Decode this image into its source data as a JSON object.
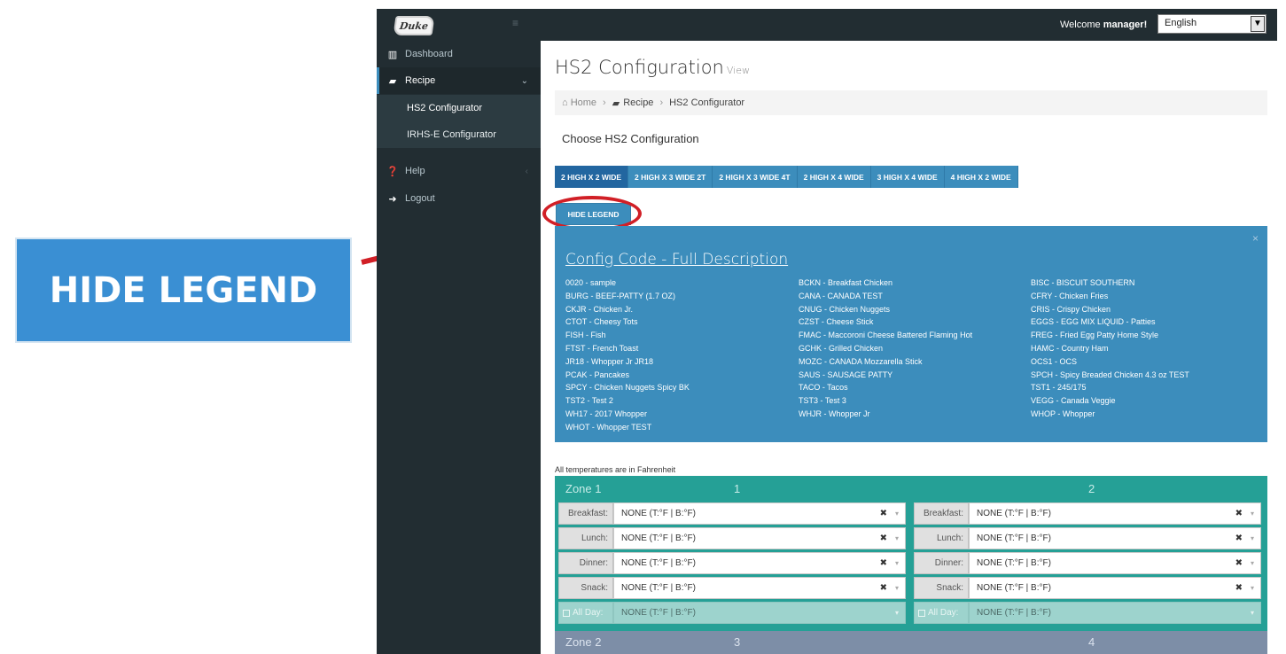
{
  "zoom_label": "HIDE LEGEND",
  "logo_text": "Duke",
  "topbar": {
    "welcome_prefix": "Welcome ",
    "user": "manager",
    "welcome_suffix": "!",
    "language": "English"
  },
  "sidebar": {
    "items": [
      {
        "label": "Dashboard",
        "icon": "bar-chart-icon"
      },
      {
        "label": "Recipe",
        "icon": "book-icon"
      },
      {
        "label": "HS2 Configurator"
      },
      {
        "label": "IRHS-E Configurator"
      },
      {
        "label": "Help",
        "icon": "question-icon"
      },
      {
        "label": "Logout",
        "icon": "logout-icon"
      }
    ]
  },
  "page": {
    "title": "HS2 Configuration",
    "subtitle": "View"
  },
  "breadcrumb": {
    "home": "Home",
    "recipe": "Recipe",
    "current": "HS2 Configurator"
  },
  "choose_label": "Choose HS2 Configuration",
  "tabs": [
    "2 HIGH X 2 WIDE",
    "2 HIGH X 3 WIDE 2T",
    "2 HIGH X 3 WIDE 4T",
    "2 HIGH X 4 WIDE",
    "3 HIGH X 4 WIDE",
    "4 HIGH X 2 WIDE"
  ],
  "hide_legend_label": "HIDE LEGEND",
  "legend": {
    "title": "Config Code - Full Description",
    "close": "×",
    "col1": [
      "0020 - sample",
      "BURG - BEEF-PATTY (1.7 OZ)",
      "CKJR - Chicken Jr.",
      "CTOT - Cheesy Tots",
      "FISH - Fish",
      "FTST - French Toast",
      "JR18 - Whopper Jr JR18",
      "PCAK - Pancakes",
      "SPCY - Chicken Nuggets Spicy BK",
      "TST2 - Test 2",
      "WH17 - 2017 Whopper",
      "WHOT - Whopper TEST"
    ],
    "col2": [
      "BCKN - Breakfast Chicken",
      "CANA - CANADA TEST",
      "CNUG - Chicken Nuggets",
      "CZST - Cheese Stick",
      "FMAC - Maccoroni Cheese Battered Flaming Hot",
      "GCHK - Grilled Chicken",
      "MOZC - CANADA Mozzarella Stick",
      "SAUS - SAUSAGE PATTY",
      "TACO - Tacos",
      "TST3 - Test 3",
      "WHJR - Whopper Jr"
    ],
    "col3": [
      "BISC - BISCUIT SOUTHERN",
      "CFRY - Chicken Fries",
      "CRIS - Crispy Chicken",
      "EGGS - EGG MIX LIQUID - Patties",
      "FREG - Fried Egg Patty Home Style",
      "HAMC - Country Ham",
      "OCS1 - OCS",
      "SPCH - Spicy Breaded Chicken 4.3 oz TEST",
      "TST1 - 245/175",
      "VEGG - Canada Veggie",
      "WHOP - Whopper"
    ]
  },
  "temp_note": "All temperatures are in Fahrenheit",
  "zone1": {
    "title": "Zone 1",
    "col_a": "1",
    "col_b": "2"
  },
  "zone2": {
    "title": "Zone 2",
    "col_a": "3",
    "col_b": "4"
  },
  "meal_rows": [
    {
      "label": "Breakfast:",
      "value": "NONE (T:°F | B:°F)"
    },
    {
      "label": "Lunch:",
      "value": "NONE (T:°F | B:°F)"
    },
    {
      "label": "Dinner:",
      "value": "NONE (T:°F | B:°F)"
    },
    {
      "label": "Snack:",
      "value": "NONE (T:°F | B:°F)"
    }
  ],
  "allday": {
    "label": "All Day:",
    "value": "NONE (T:°F | B:°F)"
  },
  "colors": {
    "sidebar": "#222d32",
    "primary": "#3c8dbc",
    "zone1": "#25a096",
    "zone2": "#7d8ea7",
    "highlight": "#d11f26"
  }
}
